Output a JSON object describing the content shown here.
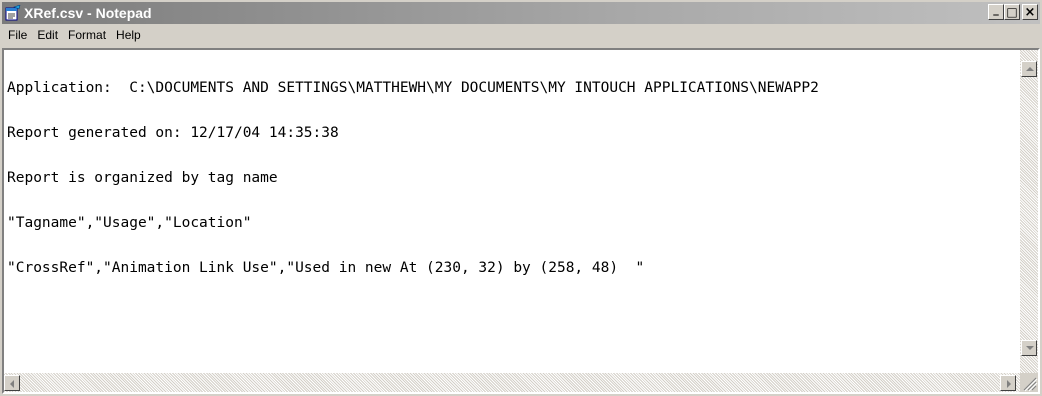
{
  "window": {
    "title": "XRef.csv - Notepad",
    "icons": {
      "app": "notepad-icon",
      "minimize": "minimize-icon",
      "maximize": "maximize-icon",
      "close": "close-icon"
    },
    "button_glyphs": {
      "minimize": "_",
      "maximize": "□",
      "close": "×"
    }
  },
  "menu": {
    "items": [
      "File",
      "Edit",
      "Format",
      "Help"
    ]
  },
  "document": {
    "lines": [
      "Application:  C:\\DOCUMENTS AND SETTINGS\\MATTHEWH\\MY DOCUMENTS\\MY INTOUCH APPLICATIONS\\NEWAPP2",
      "Report generated on: 12/17/04 14:35:38",
      "Report is organized by tag name",
      "\"Tagname\",\"Usage\",\"Location\"",
      "\"CrossRef\",\"Animation Link Use\",\"Used in new At (230, 32) by (258, 48)  \""
    ]
  },
  "colors": {
    "titlebar_inactive_start": "#7b7b7b",
    "titlebar_inactive_end": "#c0c0c0",
    "face": "#d4d0c8",
    "text": "#000000",
    "edit_background": "#ffffff"
  }
}
